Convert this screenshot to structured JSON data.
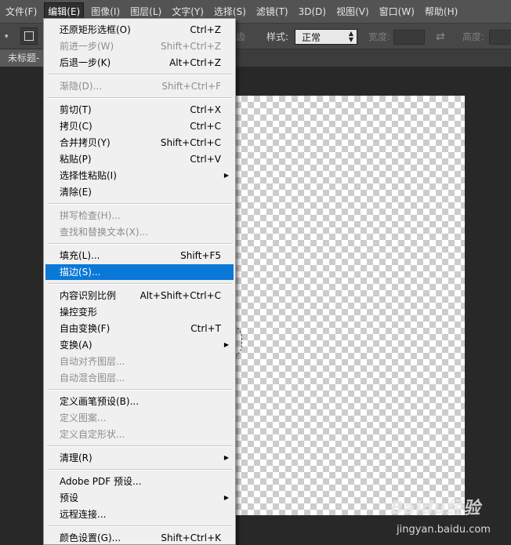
{
  "menubar": {
    "items": [
      {
        "label": "文件(F)"
      },
      {
        "label": "编辑(E)"
      },
      {
        "label": "图像(I)"
      },
      {
        "label": "图层(L)"
      },
      {
        "label": "文字(Y)"
      },
      {
        "label": "选择(S)"
      },
      {
        "label": "滤镜(T)"
      },
      {
        "label": "3D(D)"
      },
      {
        "label": "视图(V)"
      },
      {
        "label": "窗口(W)"
      },
      {
        "label": "帮助(H)"
      }
    ]
  },
  "options_bar": {
    "hidden_fragment": "齿",
    "style_label": "样式:",
    "style_value": "正常",
    "width_label": "宽度:",
    "height_label": "高度:"
  },
  "document": {
    "tab_label": "未标题-"
  },
  "edit_menu": {
    "items": [
      {
        "label": "还原矩形选框(O)",
        "shortcut": "Ctrl+Z",
        "state": "enabled"
      },
      {
        "label": "前进一步(W)",
        "shortcut": "Shift+Ctrl+Z",
        "state": "disabled"
      },
      {
        "label": "后退一步(K)",
        "shortcut": "Alt+Ctrl+Z",
        "state": "enabled"
      },
      {
        "label": "渐隐(D)...",
        "shortcut": "Shift+Ctrl+F",
        "state": "disabled"
      },
      {
        "label": "剪切(T)",
        "shortcut": "Ctrl+X",
        "state": "enabled"
      },
      {
        "label": "拷贝(C)",
        "shortcut": "Ctrl+C",
        "state": "enabled"
      },
      {
        "label": "合并拷贝(Y)",
        "shortcut": "Shift+Ctrl+C",
        "state": "enabled"
      },
      {
        "label": "粘贴(P)",
        "shortcut": "Ctrl+V",
        "state": "enabled"
      },
      {
        "label": "选择性粘贴(I)",
        "shortcut": "",
        "state": "enabled",
        "submenu": true
      },
      {
        "label": "清除(E)",
        "shortcut": "",
        "state": "enabled"
      },
      {
        "label": "拼写检查(H)...",
        "shortcut": "",
        "state": "disabled"
      },
      {
        "label": "查找和替换文本(X)...",
        "shortcut": "",
        "state": "disabled"
      },
      {
        "label": "填充(L)...",
        "shortcut": "Shift+F5",
        "state": "enabled"
      },
      {
        "label": "描边(S)...",
        "shortcut": "",
        "state": "highlighted"
      },
      {
        "label": "内容识别比例",
        "shortcut": "Alt+Shift+Ctrl+C",
        "state": "enabled"
      },
      {
        "label": "操控变形",
        "shortcut": "",
        "state": "enabled"
      },
      {
        "label": "自由变换(F)",
        "shortcut": "Ctrl+T",
        "state": "enabled"
      },
      {
        "label": "变换(A)",
        "shortcut": "",
        "state": "enabled",
        "submenu": true
      },
      {
        "label": "自动对齐图层...",
        "shortcut": "",
        "state": "disabled"
      },
      {
        "label": "自动混合图层...",
        "shortcut": "",
        "state": "disabled"
      },
      {
        "label": "定义画笔预设(B)...",
        "shortcut": "",
        "state": "enabled"
      },
      {
        "label": "定义图案...",
        "shortcut": "",
        "state": "disabled"
      },
      {
        "label": "定义自定形状...",
        "shortcut": "",
        "state": "disabled"
      },
      {
        "label": "清理(R)",
        "shortcut": "",
        "state": "enabled",
        "submenu": true
      },
      {
        "label": "Adobe PDF 预设...",
        "shortcut": "",
        "state": "enabled"
      },
      {
        "label": "预设",
        "shortcut": "",
        "state": "enabled",
        "submenu": true
      },
      {
        "label": "远程连接...",
        "shortcut": "",
        "state": "enabled"
      },
      {
        "label": "颜色设置(G)...",
        "shortcut": "Shift+Ctrl+K",
        "state": "enabled"
      }
    ]
  },
  "watermark": {
    "logo": "Baidu经验",
    "url": "jingyan.baidu.com"
  },
  "colors": {
    "highlight": "#0a78d7",
    "menu_bg": "#f0f0f0",
    "app_bg": "#282828"
  }
}
